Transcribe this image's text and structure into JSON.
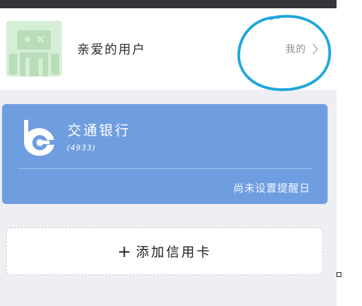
{
  "profile": {
    "username": "亲爱的用户",
    "mine_label": "我的",
    "avatar_icon": "robot-avatar-icon",
    "chevron_icon": "chevron-right-icon"
  },
  "annotation": {
    "shape": "hand-drawn-circle",
    "color": "#1fa6dc"
  },
  "card": {
    "bank_name": "交通银行",
    "card_tail": "(4933)",
    "reminder_status": "尚未设置提醒日",
    "logo_icon": "bank-of-communications-logo",
    "background_color": "#6f9ee0"
  },
  "add_card": {
    "plus": "+",
    "label": "添加信用卡"
  },
  "colors": {
    "page_background": "#efeef3",
    "status_strip": "#34343a",
    "avatar_background": "#d6eed6"
  }
}
